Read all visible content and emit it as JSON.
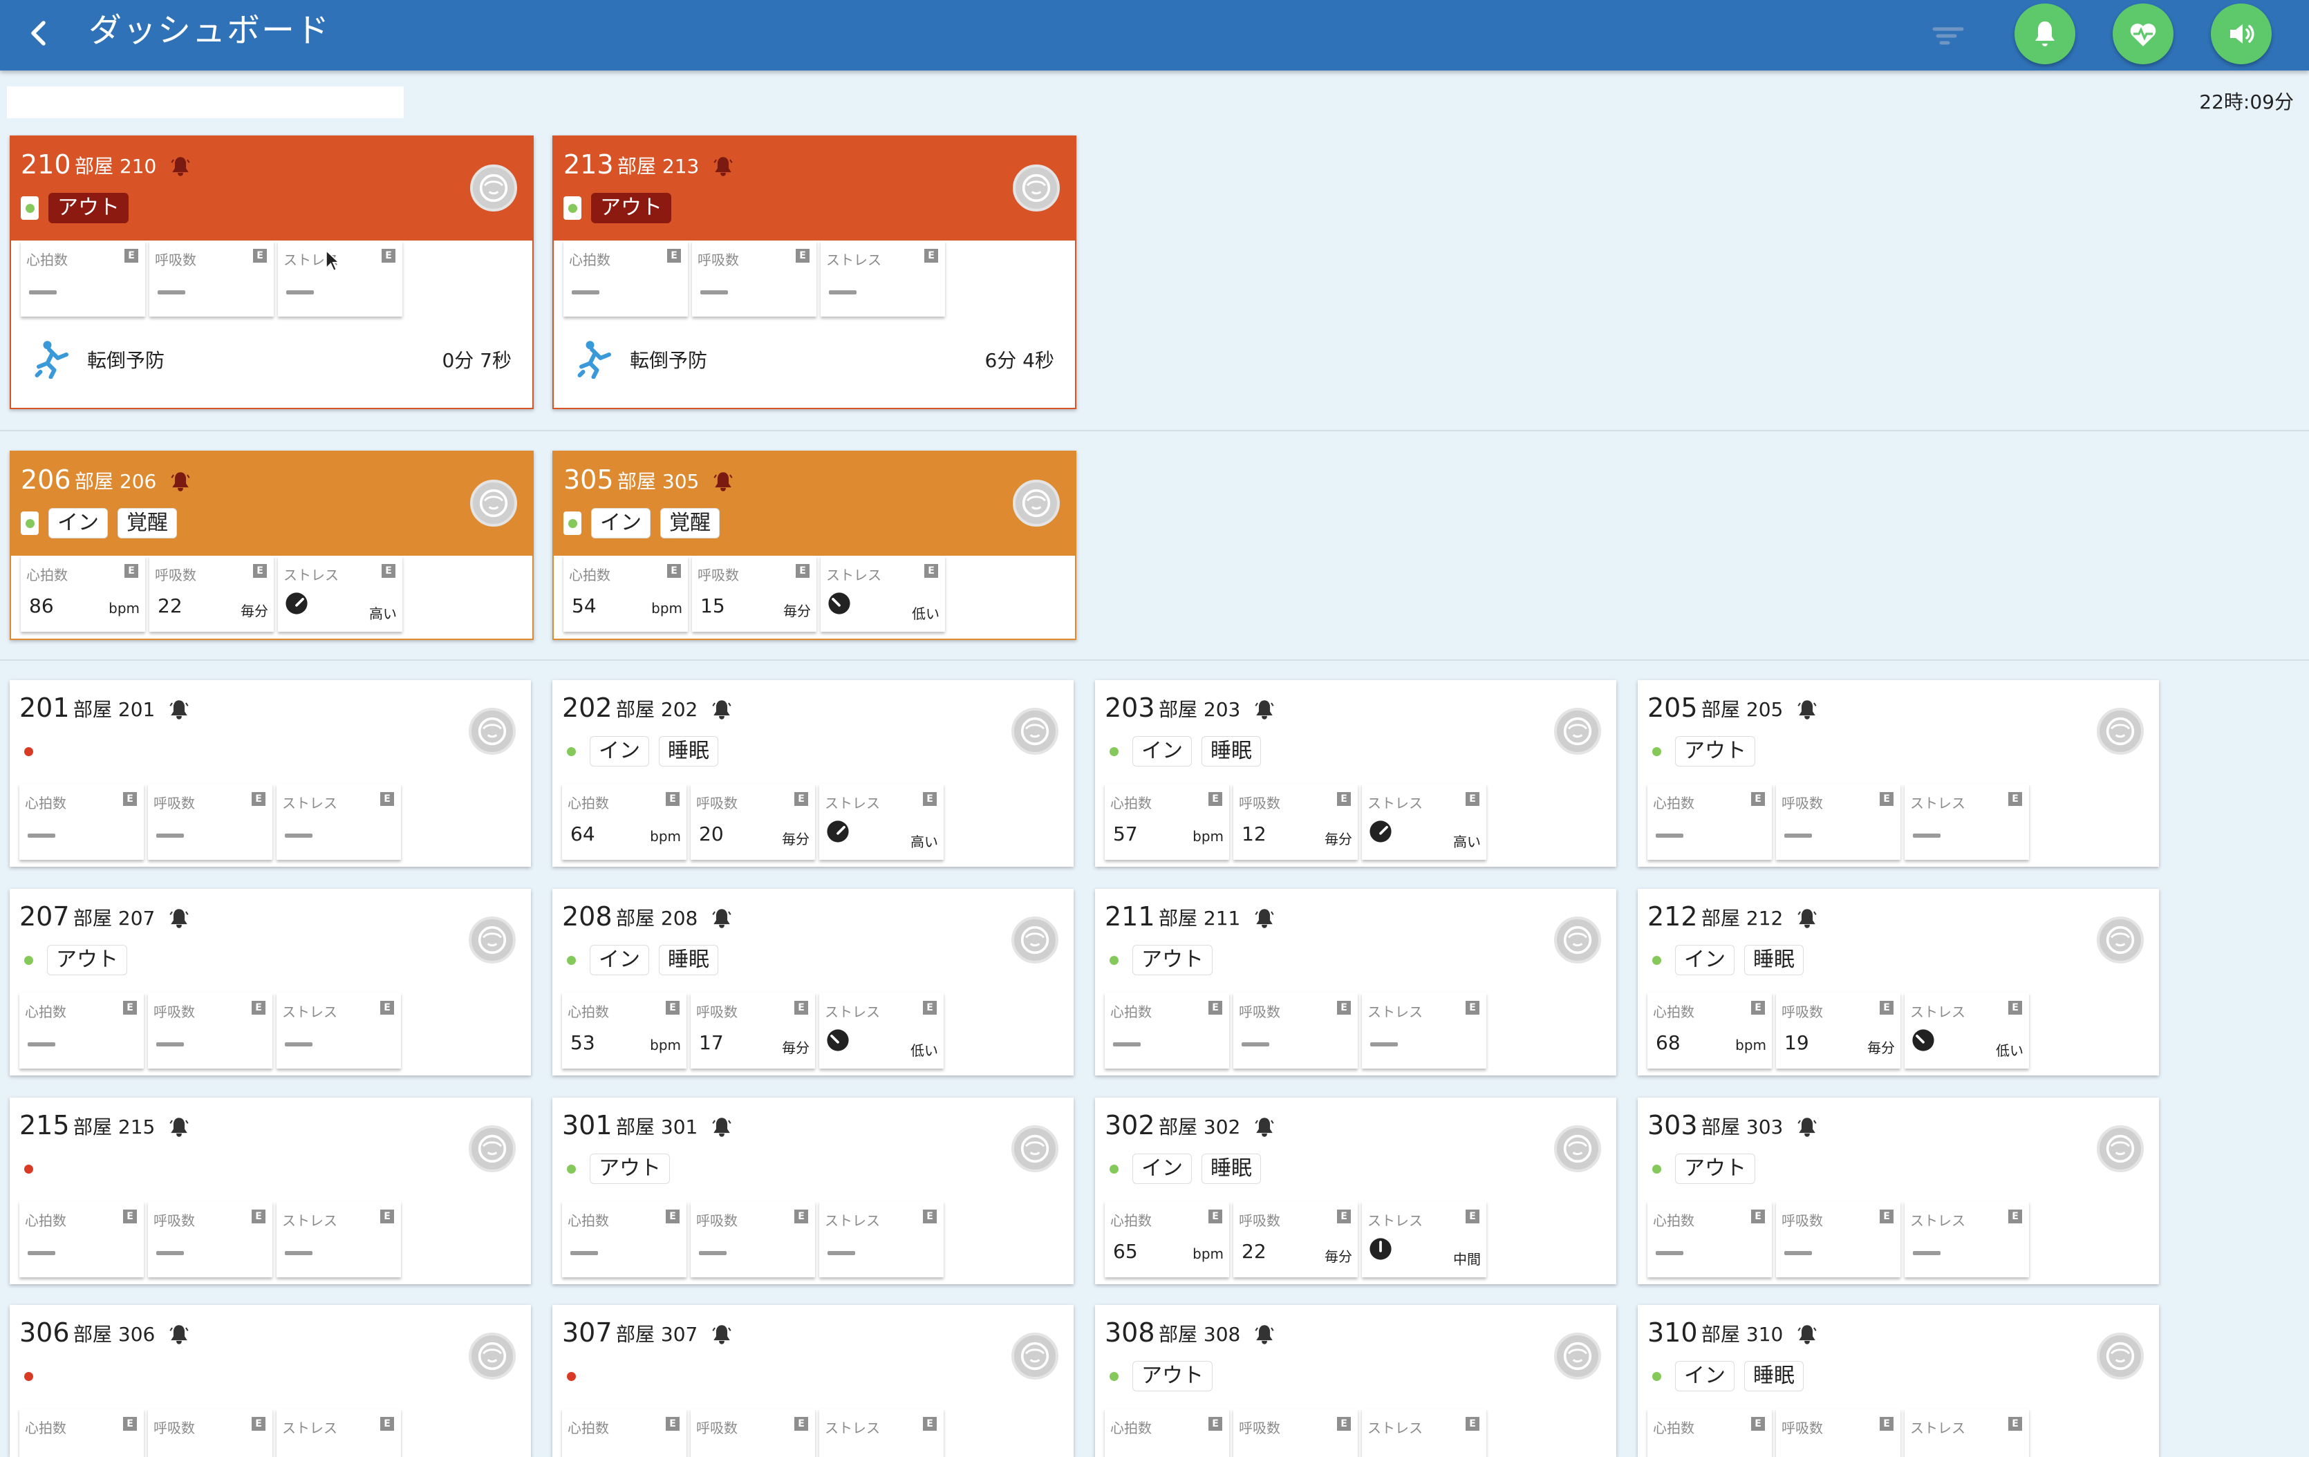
{
  "header": {
    "title": "ダッシュボード"
  },
  "clock": "22時:09分",
  "metric_labels": {
    "heart": "心拍数",
    "resp": "呼吸数",
    "stress": "ストレス",
    "e": "E"
  },
  "units": {
    "bpm": "bpm",
    "per_min": "毎分"
  },
  "colors": {
    "header": "#2f72b8",
    "alert_red": "#d85426",
    "alert_orange": "#de8a30",
    "action_green": "#5dc96b",
    "bg": "#e8f2f9"
  },
  "cards": [
    {
      "num": "210",
      "name": "部屋 210",
      "state": "red",
      "status": "ok",
      "tags": [
        "アウト"
      ],
      "metrics": null,
      "fall": {
        "label": "転倒予防",
        "time": "0分 7秒"
      }
    },
    {
      "num": "213",
      "name": "部屋 213",
      "state": "red",
      "status": "ok",
      "tags": [
        "アウト"
      ],
      "metrics": null,
      "fall": {
        "label": "転倒予防",
        "time": "6分 4秒"
      }
    },
    {
      "num": "206",
      "name": "部屋 206",
      "state": "orange",
      "status": "ok",
      "tags": [
        "イン",
        "覚醒"
      ],
      "metrics": {
        "hr": "86",
        "rr": "22",
        "stress": "高い"
      }
    },
    {
      "num": "305",
      "name": "部屋 305",
      "state": "orange",
      "status": "ok",
      "tags": [
        "イン",
        "覚醒"
      ],
      "metrics": {
        "hr": "54",
        "rr": "15",
        "stress": "低い"
      }
    },
    {
      "num": "201",
      "name": "部屋 201",
      "state": "normal",
      "status": "err",
      "tags": [],
      "metrics": null
    },
    {
      "num": "202",
      "name": "部屋 202",
      "state": "normal",
      "status": "ok",
      "tags": [
        "イン",
        "睡眠"
      ],
      "metrics": {
        "hr": "64",
        "rr": "20",
        "stress": "高い"
      }
    },
    {
      "num": "203",
      "name": "部屋 203",
      "state": "normal",
      "status": "ok",
      "tags": [
        "イン",
        "睡眠"
      ],
      "metrics": {
        "hr": "57",
        "rr": "12",
        "stress": "高い"
      }
    },
    {
      "num": "205",
      "name": "部屋 205",
      "state": "normal",
      "status": "ok",
      "tags": [
        "アウト"
      ],
      "metrics": null
    },
    {
      "num": "207",
      "name": "部屋 207",
      "state": "normal",
      "status": "ok",
      "tags": [
        "アウト"
      ],
      "metrics": null
    },
    {
      "num": "208",
      "name": "部屋 208",
      "state": "normal",
      "status": "ok",
      "tags": [
        "イン",
        "睡眠"
      ],
      "metrics": {
        "hr": "53",
        "rr": "17",
        "stress": "低い"
      }
    },
    {
      "num": "211",
      "name": "部屋 211",
      "state": "normal",
      "status": "ok",
      "tags": [
        "アウト"
      ],
      "metrics": null
    },
    {
      "num": "212",
      "name": "部屋 212",
      "state": "normal",
      "status": "ok",
      "tags": [
        "イン",
        "睡眠"
      ],
      "metrics": {
        "hr": "68",
        "rr": "19",
        "stress": "低い"
      }
    },
    {
      "num": "215",
      "name": "部屋 215",
      "state": "normal",
      "status": "err",
      "tags": [],
      "metrics": null
    },
    {
      "num": "301",
      "name": "部屋 301",
      "state": "normal",
      "status": "ok",
      "tags": [
        "アウト"
      ],
      "metrics": null
    },
    {
      "num": "302",
      "name": "部屋 302",
      "state": "normal",
      "status": "ok",
      "tags": [
        "イン",
        "睡眠"
      ],
      "metrics": {
        "hr": "65",
        "rr": "22",
        "stress": "中間"
      }
    },
    {
      "num": "303",
      "name": "部屋 303",
      "state": "normal",
      "status": "ok",
      "tags": [
        "アウト"
      ],
      "metrics": null
    },
    {
      "num": "306",
      "name": "部屋 306",
      "state": "normal",
      "status": "err",
      "tags": [],
      "metrics": null
    },
    {
      "num": "307",
      "name": "部屋 307",
      "state": "normal",
      "status": "err",
      "tags": [],
      "metrics": null
    },
    {
      "num": "308",
      "name": "部屋 308",
      "state": "normal",
      "status": "ok",
      "tags": [
        "アウト"
      ],
      "metrics": null
    },
    {
      "num": "310",
      "name": "部屋 310",
      "state": "normal",
      "status": "ok",
      "tags": [
        "イン",
        "睡眠"
      ],
      "metrics": null
    }
  ]
}
